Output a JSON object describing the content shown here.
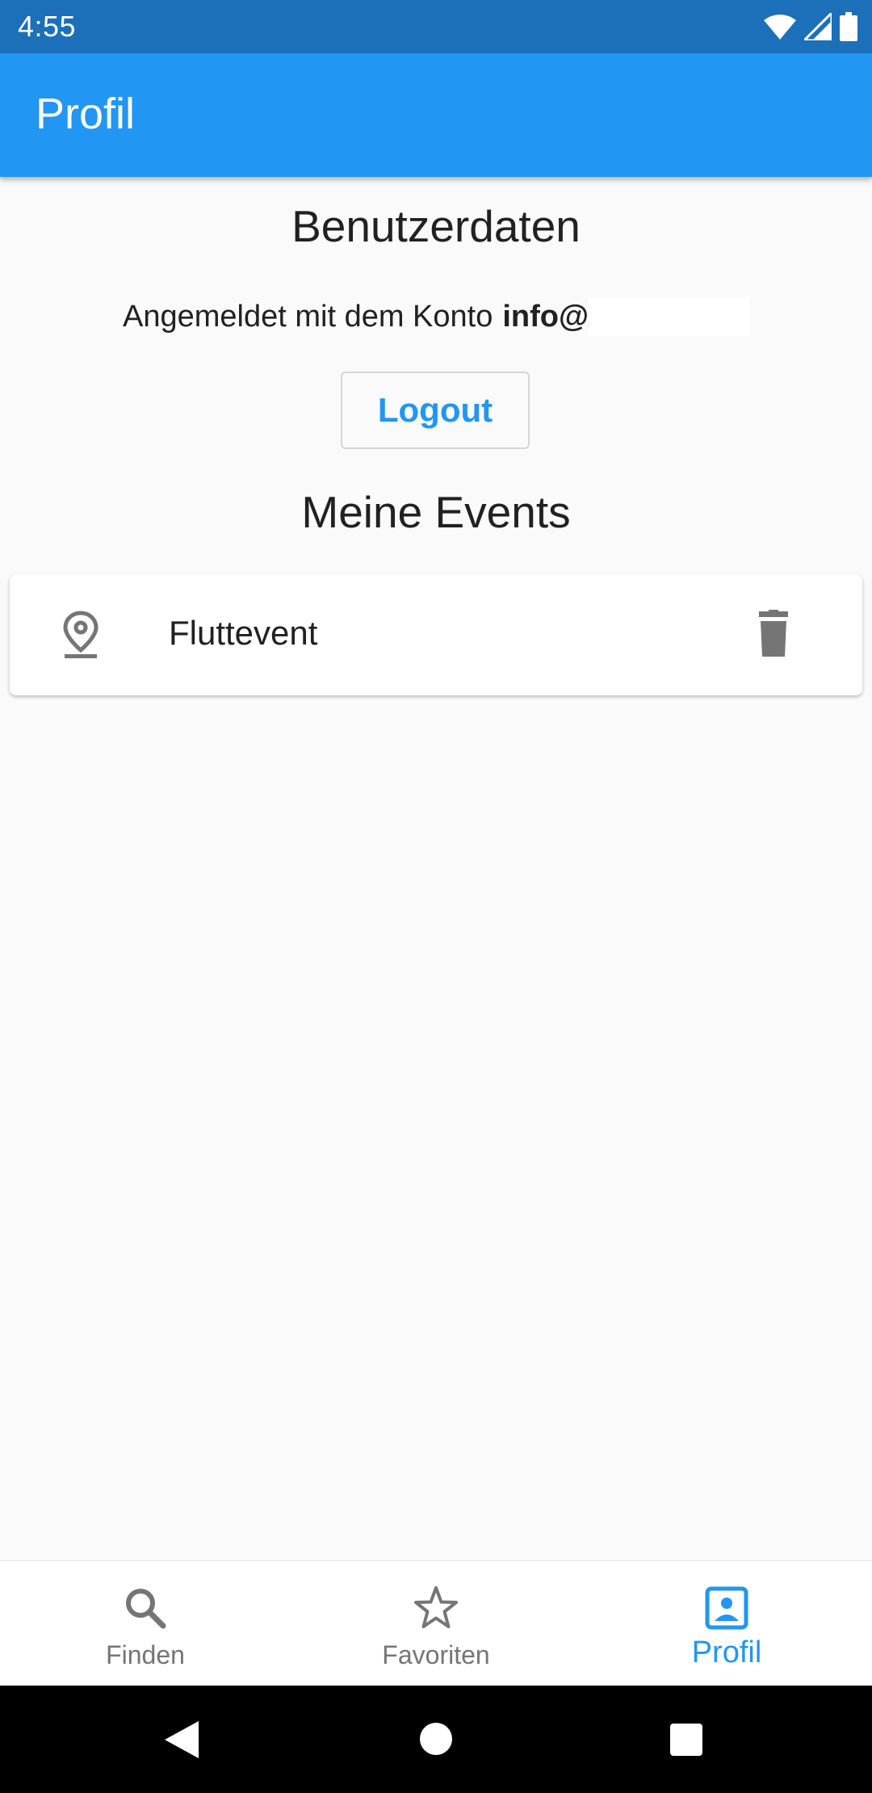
{
  "status_bar": {
    "time": "4:55"
  },
  "app_bar": {
    "title": "Profil"
  },
  "user_data": {
    "heading": "Benutzerdaten",
    "account_prefix": "Angemeldet mit dem Konto",
    "account_email": "info@",
    "logout_label": "Logout"
  },
  "events": {
    "heading": "Meine Events",
    "items": [
      {
        "title": "Fluttevent",
        "icon": "location-pin-icon",
        "action_icon": "trash-icon"
      }
    ]
  },
  "bottom_nav": {
    "items": [
      {
        "label": "Finden",
        "icon": "search-icon",
        "active": false
      },
      {
        "label": "Favoriten",
        "icon": "star-icon",
        "active": false
      },
      {
        "label": "Profil",
        "icon": "profile-card-icon",
        "active": true
      }
    ]
  },
  "colors": {
    "primary": "#2196f3",
    "status_bar": "#1c6fb9",
    "inactive": "#757575",
    "background": "#fafafa"
  }
}
